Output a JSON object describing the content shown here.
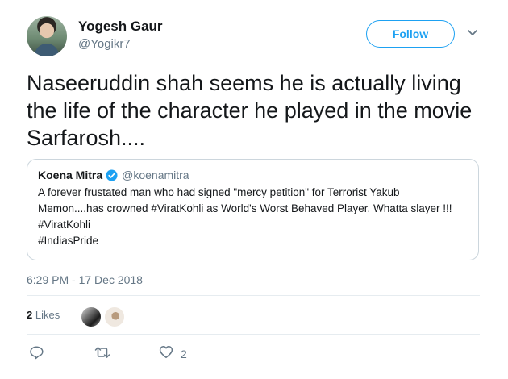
{
  "author": {
    "name": "Yogesh Gaur",
    "handle": "@Yogikr7"
  },
  "follow_label": "Follow",
  "tweet": {
    "text": "Naseeruddin shah seems he is actually living the life of the character he played in the movie Sarfarosh...."
  },
  "quoted": {
    "name": "Koena Mitra",
    "handle": "@koenamitra",
    "lines": [
      "A forever frustated  man who had signed \"mercy petition\" for Terrorist Yakub",
      "Memon....has crowned  #ViratKohli as World's Worst Behaved Player. Whatta slayer !!!",
      "#ViratKohli",
      "#IndiasPride"
    ]
  },
  "timestamp": "6:29 PM - 17 Dec 2018",
  "likes": {
    "count": "2",
    "label": "Likes"
  },
  "actions": {
    "like_count": "2"
  },
  "colors": {
    "accent": "#1da1f2",
    "muted": "#657786",
    "border": "#ccd6dd"
  },
  "icons": [
    "chevron-down-icon",
    "verified-icon",
    "reply-icon",
    "retweet-icon",
    "heart-icon"
  ]
}
